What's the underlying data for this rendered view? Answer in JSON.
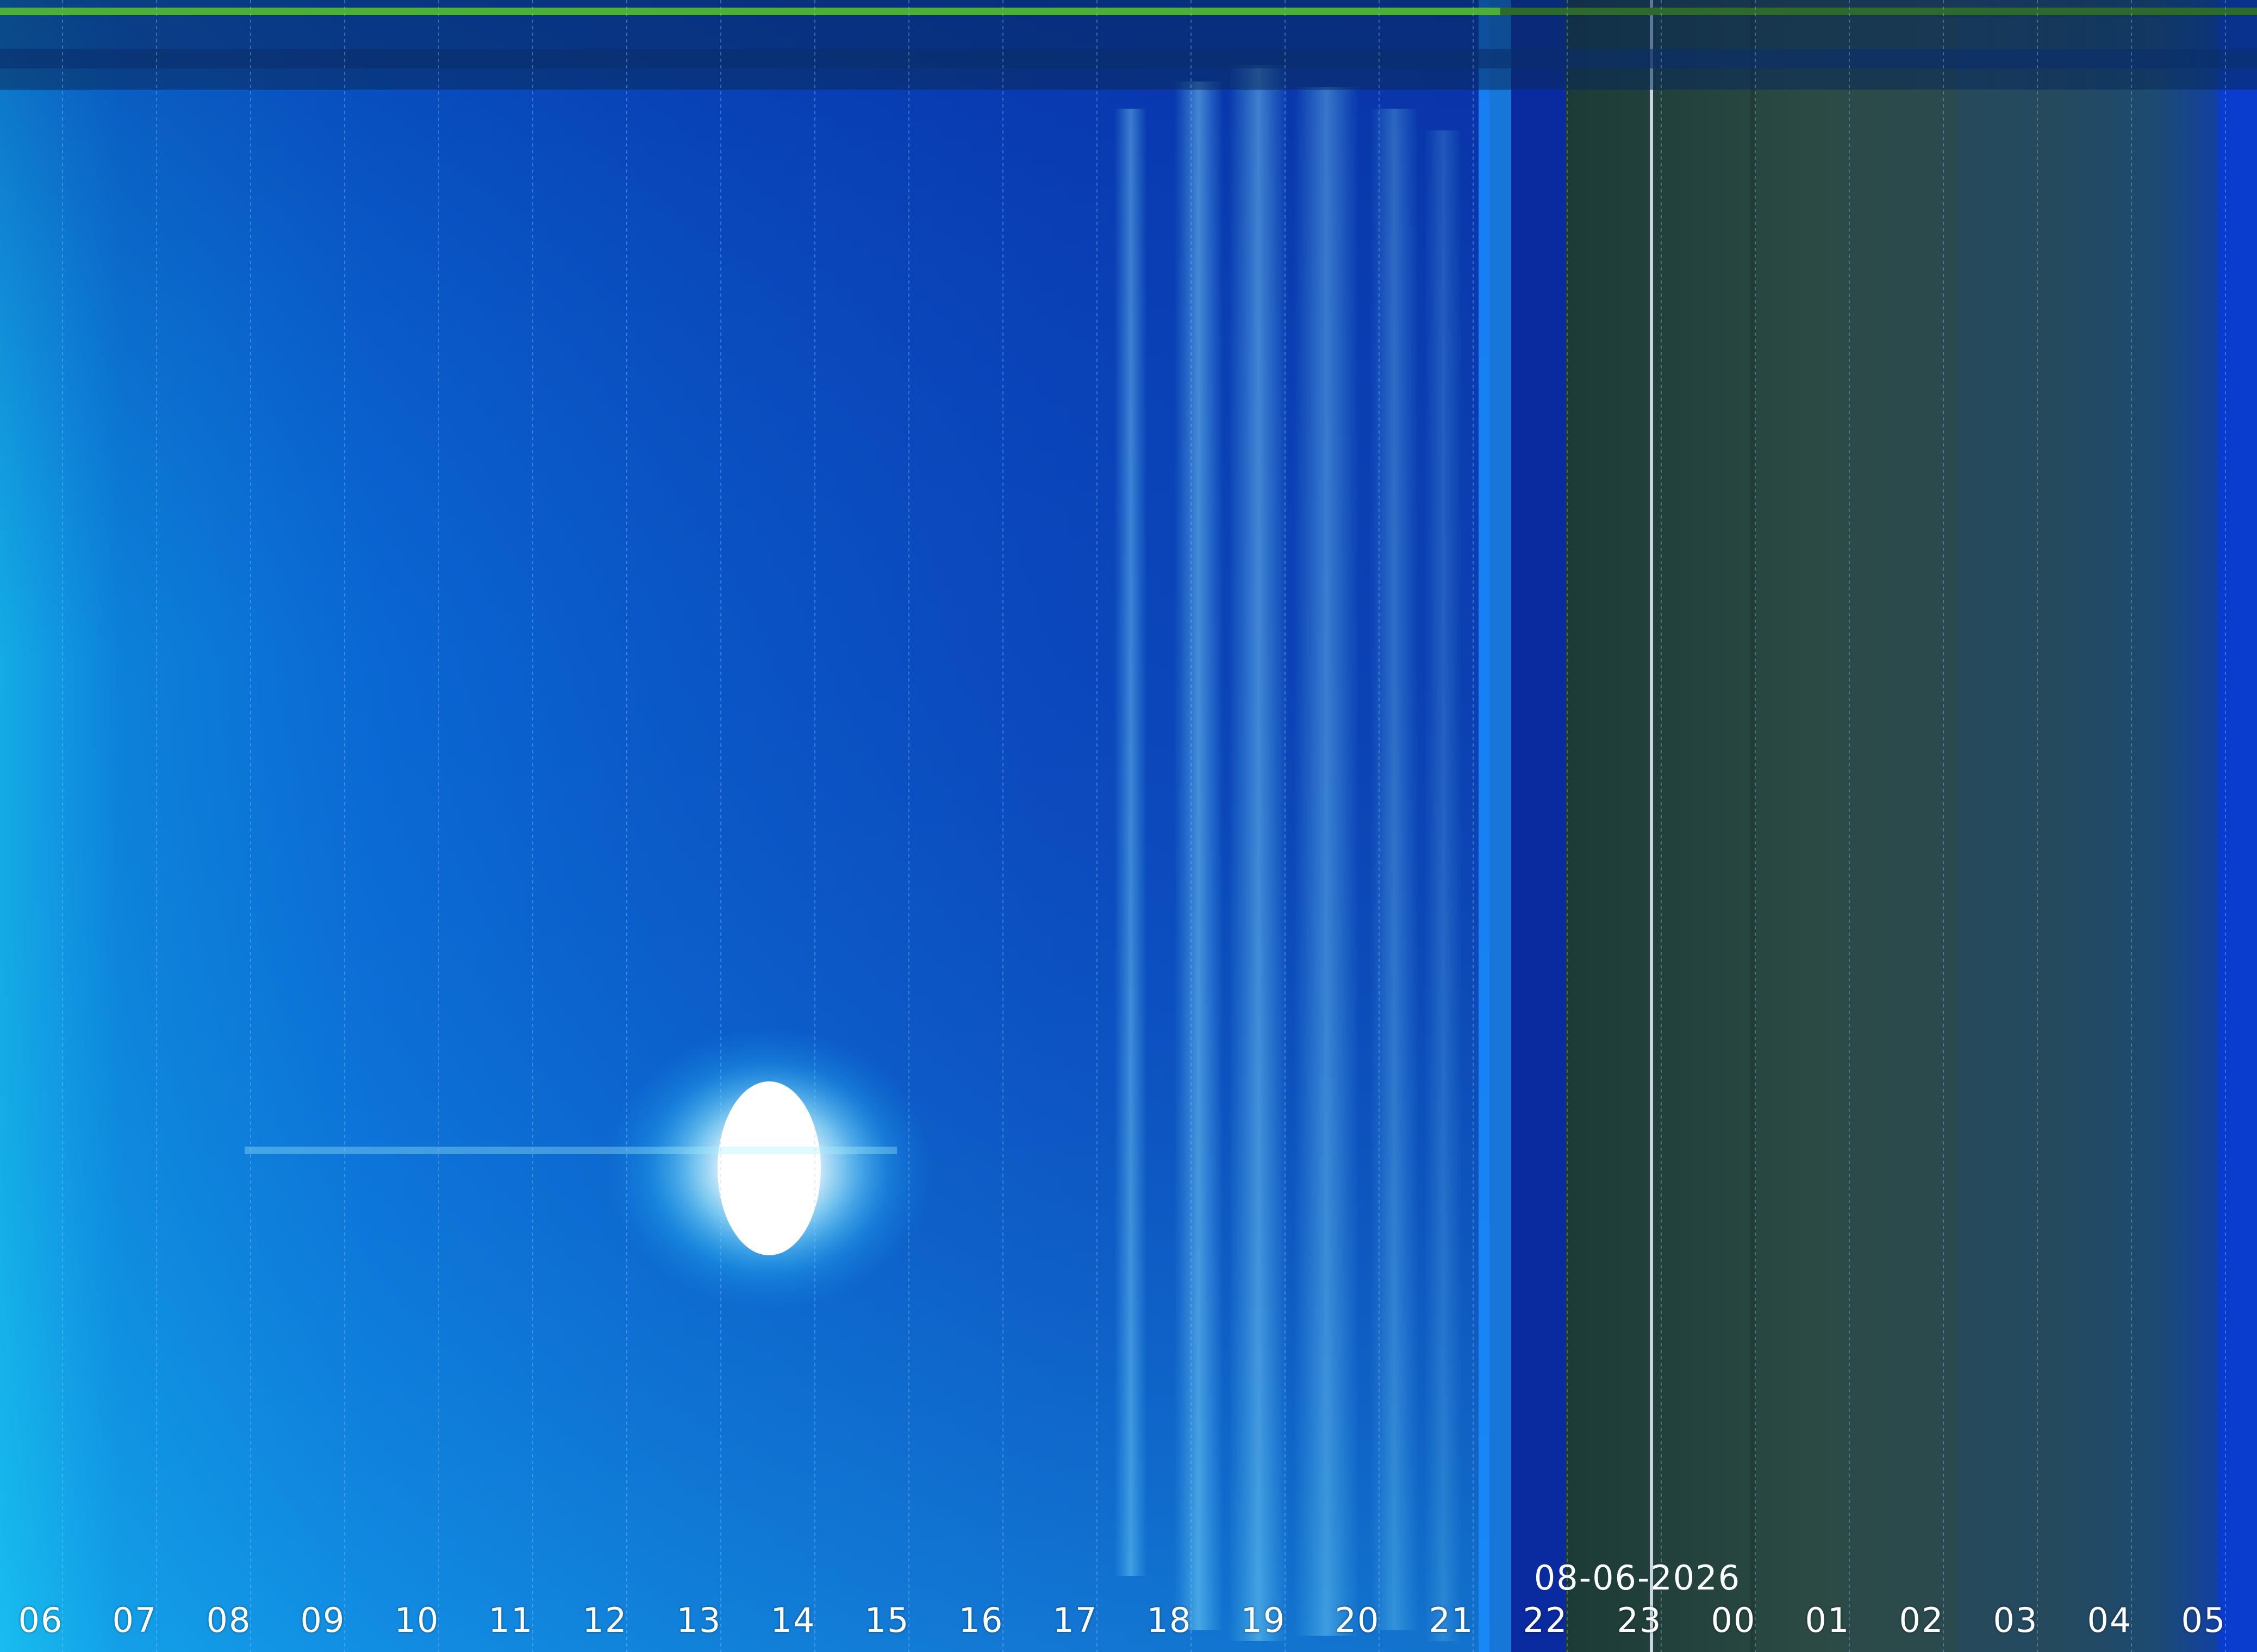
{
  "image": {
    "kind": "keogram",
    "date": "08-06-2026",
    "hour_labels": [
      "06",
      "07",
      "08",
      "09",
      "10",
      "11",
      "12",
      "13",
      "14",
      "15",
      "16",
      "17",
      "18",
      "19",
      "20",
      "21",
      "22",
      "23",
      "00",
      "01",
      "02",
      "03",
      "04",
      "05"
    ]
  },
  "colors": {
    "day_sky": "#0a6fd8",
    "day_sky_deep": "#0b3fb0",
    "twilight": "#0a3aa8",
    "night_sky": "#2f4a44",
    "night_band": "#2a3f4f",
    "top_bar": "#4caf3a",
    "sun": "#ffffff",
    "grid_line": "#9ec8ff",
    "label": "#ffffff"
  }
}
